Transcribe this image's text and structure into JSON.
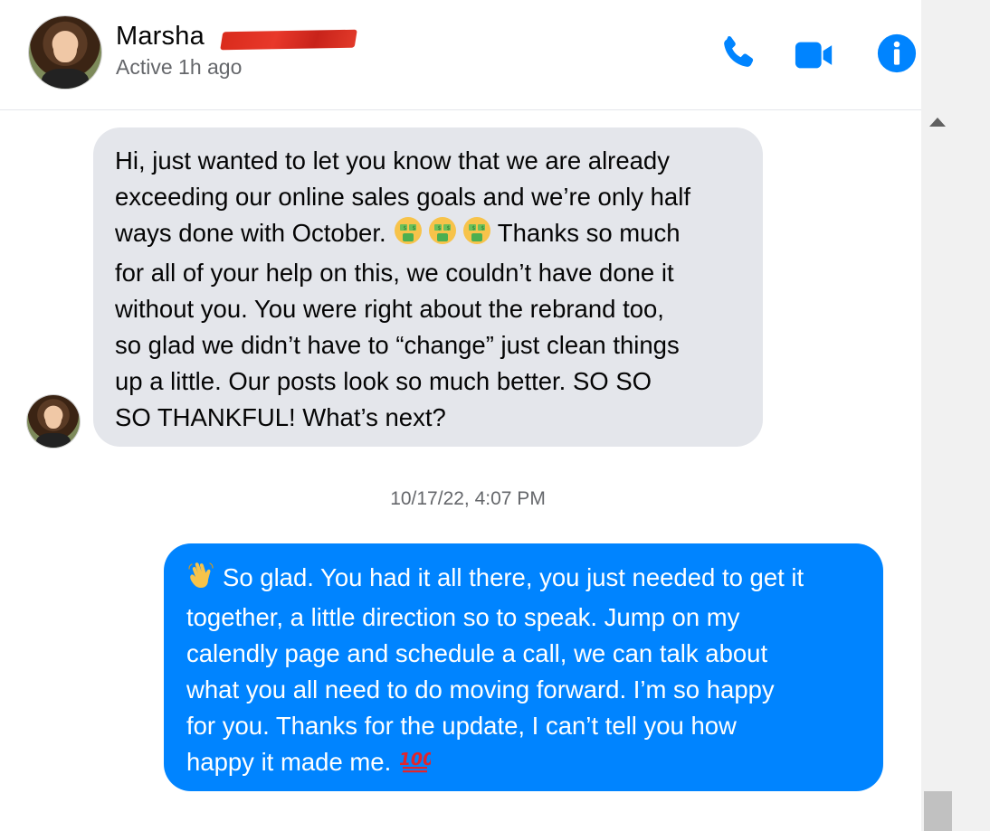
{
  "header": {
    "contact_name": "Marsha",
    "status": "Active 1h ago",
    "icons": [
      "phone-icon",
      "video-camera-icon",
      "info-icon"
    ],
    "accent_color": "#0084ff"
  },
  "conversation": {
    "incoming_message": {
      "lines": [
        "Hi, just wanted to let you know that we are already",
        "exceeding our online sales goals and we’re only half",
        "ways done with October.",
        "Thanks so much",
        "for all of your help on this, we couldn’t have done it",
        "without you.  You were right about the rebrand too,",
        "so glad we didn’t have to “change” just clean things",
        "up a little.  Our posts look so much better.  SO SO",
        "SO THANKFUL!  What’s next?"
      ],
      "emojis": [
        "money-mouth-face-icon",
        "money-mouth-face-icon",
        "money-mouth-face-icon"
      ],
      "bubble_color": "#e4e6eb"
    },
    "timestamp": "10/17/22, 4:07 PM",
    "outgoing_message": {
      "lines": [
        "So glad. You had it all there, you just needed to get it",
        "together, a little direction so to speak. Jump on my",
        "calendly page and schedule a call, we can talk about",
        "what you all need to do moving forward. I’m so happy",
        "for you. Thanks for the update, I can’t tell you how",
        "happy it made me."
      ],
      "emojis": [
        "waving-hand-icon",
        "hundred-points-icon"
      ],
      "bubble_color": "#0084ff"
    }
  }
}
